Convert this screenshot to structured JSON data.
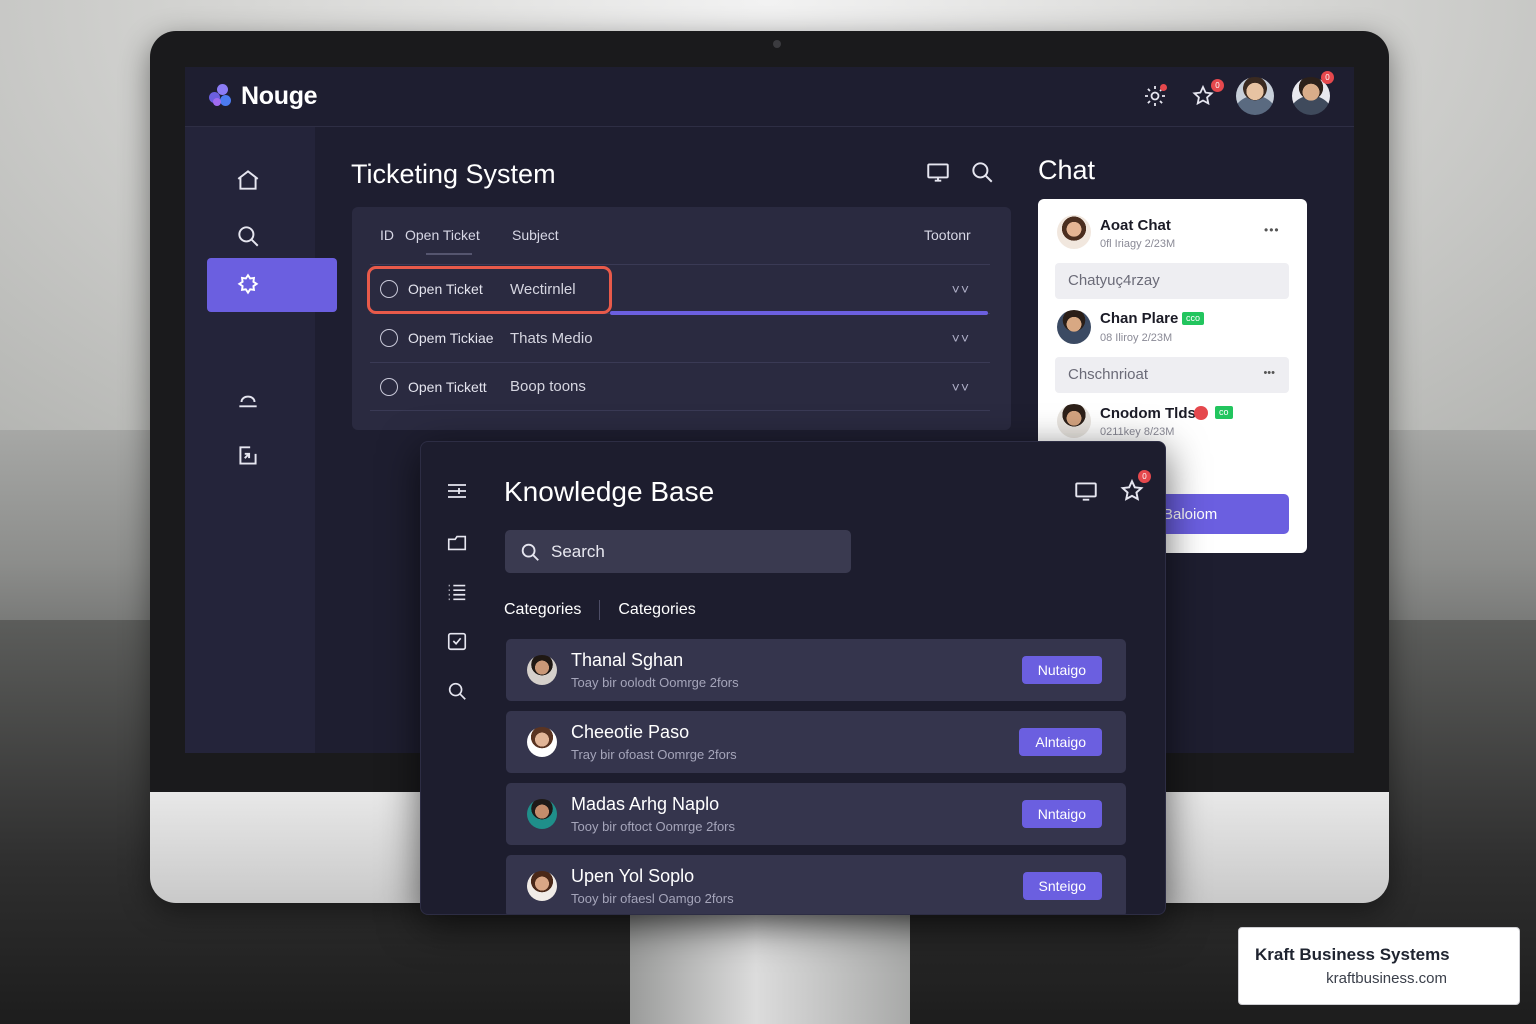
{
  "app": {
    "name": "Nouge",
    "notification_count": "0",
    "profile_badge": "0"
  },
  "ticketing": {
    "title": "Ticketing System",
    "columns": {
      "id": "ID",
      "status": "Open Ticket",
      "subject": "Subject",
      "action": "Tootonr"
    },
    "rows": [
      {
        "status": "Open Ticket",
        "subject": "Wectirnlel",
        "more": "˅˅"
      },
      {
        "status": "Opem Tickiae",
        "subject": "Thats Medio",
        "more": "˅˅"
      },
      {
        "status": "Open Tickett",
        "subject": "Boop toons",
        "more": "˅˅"
      }
    ]
  },
  "chat": {
    "title": "Chat",
    "messages": [
      {
        "name": "Aoat Chat",
        "time": "0fl Iriagy 2/23M",
        "more": "•••"
      },
      {
        "preview": "Chatyuç4rzay"
      },
      {
        "name": "Chan Plare",
        "time": "08 Iliroy 2/23M",
        "tag": "cco"
      },
      {
        "preview": "Chschnrioat",
        "more": "•••"
      },
      {
        "name": "Cnodom Tlds",
        "time": "0211key 8/23M",
        "tag": "co"
      }
    ],
    "button": "Baloiom"
  },
  "knowledge_base": {
    "title": "Knowledge Base",
    "badge": "0",
    "search_placeholder": "Search",
    "categories": [
      "Categories",
      "Categories"
    ],
    "articles": [
      {
        "name": "Thanal Sghan",
        "subtitle": "Toay bir oolodt Oomrge 2fors",
        "tag": "Nutaigo"
      },
      {
        "name": "Cheeotie Paso",
        "subtitle": "Tray bir ofoast Oomrge 2fors",
        "tag": "Alntaigo"
      },
      {
        "name": "Madas Arhg Naplo",
        "subtitle": "Tooy bir oftoct Oomrge 2fors",
        "tag": "Nntaigo"
      },
      {
        "name": "Upen Yol Soplo",
        "subtitle": "Tooy bir ofaesl Oamgo 2fors",
        "tag": "Snteigo"
      }
    ]
  },
  "brand": {
    "name": "Kraft Business Systems",
    "url": "kraftbusiness.com"
  },
  "colors": {
    "accent": "#6b5fe0",
    "screen_bg": "#1e1e30",
    "highlight": "#e85a4a",
    "badge": "#e5484d",
    "tag_green": "#22c55e"
  }
}
